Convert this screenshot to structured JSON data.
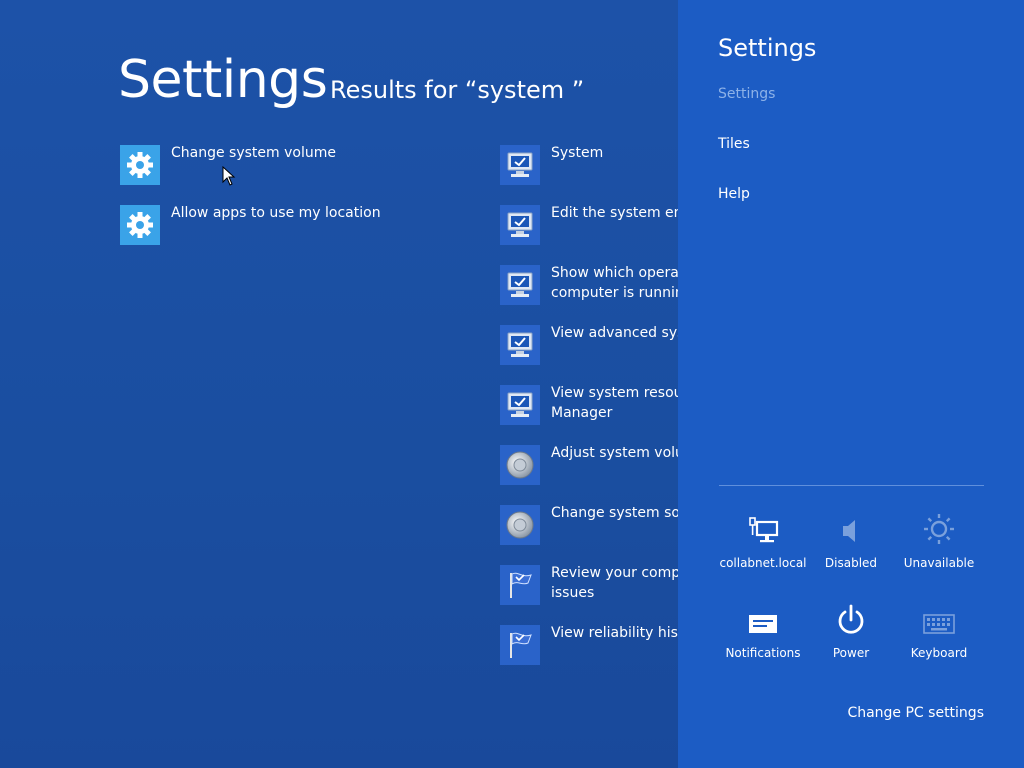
{
  "search_screen": {
    "title": "Settings",
    "results_heading": "Results for “system ”",
    "settings_results": [
      {
        "label": "Change system volume",
        "icon": "gear-icon"
      },
      {
        "label": "Allow apps to use my location",
        "icon": "gear-icon"
      }
    ],
    "control_panel_results": [
      {
        "line1": "System",
        "line2": "",
        "icon": "monitor-icon"
      },
      {
        "line1": "Edit the system envi",
        "line2": "",
        "icon": "monitor-icon"
      },
      {
        "line1": "Show which operati",
        "line2": "computer is running",
        "icon": "monitor-icon"
      },
      {
        "line1": "View advanced syste",
        "line2": "",
        "icon": "monitor-icon"
      },
      {
        "line1": "View system resourc",
        "line2": "Manager",
        "icon": "monitor-icon"
      },
      {
        "line1": "Adjust system volum",
        "line2": "",
        "icon": "speaker-icon"
      },
      {
        "line1": "Change system soun",
        "line2": "",
        "icon": "speaker-icon"
      },
      {
        "line1": "Review your compu",
        "line2": "issues",
        "icon": "flag-icon"
      },
      {
        "line1": "View reliability histo",
        "line2": "",
        "icon": "flag-icon"
      }
    ]
  },
  "charm": {
    "title": "Settings",
    "nav": [
      "Settings",
      "Tiles",
      "Help"
    ],
    "quick_settings": [
      {
        "label": "collabnet.local",
        "icon": "network-icon"
      },
      {
        "label": "Disabled",
        "icon": "volume-icon"
      },
      {
        "label": "Unavailable",
        "icon": "brightness-icon"
      },
      {
        "label": "Notifications",
        "icon": "notifications-icon"
      },
      {
        "label": "Power",
        "icon": "power-icon"
      },
      {
        "label": "Keyboard",
        "icon": "keyboard-icon"
      }
    ],
    "change_pc_settings": "Change PC settings"
  },
  "colors": {
    "background": "#1b4fa3",
    "charm_background": "#1c5cc4",
    "settings_tile": "#3aa3e8"
  }
}
